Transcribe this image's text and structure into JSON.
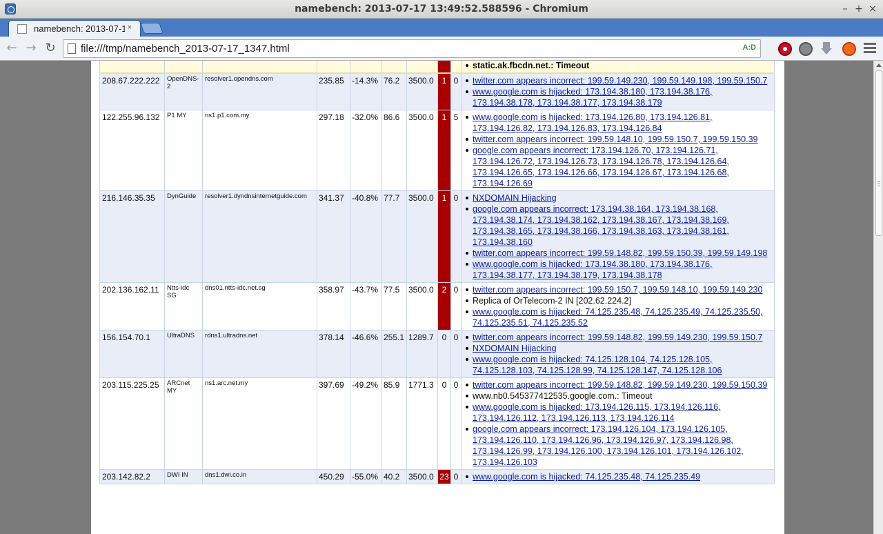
{
  "window": {
    "title": "namebench: 2013-07-17 13:49:52.588596 - Chromium",
    "min": "–",
    "max": "+",
    "close": "×"
  },
  "tab": {
    "label": "namebench: 2013-07-17 1",
    "close": "×"
  },
  "toolbar": {
    "back": "←",
    "forward": "→",
    "reload": "↻",
    "url": "file:///tmp/namebench_2013-07-17_1347.html",
    "aid": "A:D"
  },
  "results": {
    "top_row": {
      "notes": [
        "static.ak.fbcdn.net.: Timeout"
      ]
    },
    "rows": [
      {
        "ip": "208.67.222.222",
        "name": "OpenDNS-2",
        "host": "resolver1.opendns.com",
        "avg": "235.85",
        "diff": "-14.3%",
        "min": "76.2",
        "max": "3500.0",
        "errors": "1",
        "nx": "0",
        "notes": [
          {
            "text": "twitter.com appears incorrect: 199.59.149.230, 199.59.149.198, 199.59.150.7",
            "link": true
          },
          {
            "text": "www.google.com is hijacked: 173.194.38.180, 173.194.38.176, 173.194.38.178, 173.194.38.177, 173.194.38.179",
            "link": true
          }
        ]
      },
      {
        "ip": "122.255.96.132",
        "name": "P1 MY",
        "host": "ns1.p1.com.my",
        "avg": "297.18",
        "diff": "-32.0%",
        "min": "86.6",
        "max": "3500.0",
        "errors": "1",
        "nx": "5",
        "notes": [
          {
            "text": "www.google.com is hijacked: 173.194.126.80, 173.194.126.81, 173.194.126.82, 173.194.126.83, 173.194.126.84",
            "link": true
          },
          {
            "text": "twitter.com appears incorrect: 199.59.148.10, 199.59.150.7, 199.59.150.39",
            "link": true
          },
          {
            "text": "google.com appears incorrect: 173.194.126.70, 173.194.126.71, 173.194.126.72, 173.194.126.73, 173.194.126.78, 173.194.126.64, 173.194.126.65, 173.194.126.66, 173.194.126.67, 173.194.126.68, 173.194.126.69",
            "link": true
          }
        ]
      },
      {
        "ip": "216.146.35.35",
        "name": "DynGuide",
        "host": "resolver1.dyndnsinternetguide.com",
        "avg": "341.37",
        "diff": "-40.8%",
        "min": "77.7",
        "max": "3500.0",
        "errors": "1",
        "nx": "0",
        "notes": [
          {
            "text": "NXDOMAIN Hijacking",
            "link": true
          },
          {
            "text": "google.com appears incorrect: 173.194.38.164, 173.194.38.168, 173.194.38.174, 173.194.38.162, 173.194.38.167, 173.194.38.169, 173.194.38.165, 173.194.38.166, 173.194.38.163, 173.194.38.161, 173.194.38.160",
            "link": true
          },
          {
            "text": "twitter.com appears incorrect: 199.59.148.82, 199.59.150.39, 199.59.149.198",
            "link": true
          },
          {
            "text": "www.google.com is hijacked: 173.194.38.180, 173.194.38.176, 173.194.38.177, 173.194.38.179, 173.194.38.178",
            "link": true
          }
        ]
      },
      {
        "ip": "202.136.162.11",
        "name": "Ntts-idc SG",
        "host": "dns01.ntts-idc.net.sg",
        "avg": "358.97",
        "diff": "-43.7%",
        "min": "77.5",
        "max": "3500.0",
        "errors": "2",
        "nx": "0",
        "notes": [
          {
            "text": "twitter.com appears incorrect: 199.59.150.7, 199.59.148.10, 199.59.149.230",
            "link": true
          },
          {
            "text": "Replica of OrTelecom-2 IN [202.62.224.2]",
            "link": false
          },
          {
            "text": "www.google.com is hijacked: 74.125.235.48, 74.125.235.49, 74.125.235.50, 74.125.235.51, 74.125.235.52",
            "link": true
          }
        ]
      },
      {
        "ip": "156.154.70.1",
        "name": "UltraDNS",
        "host": "rdns1.ultradns.net",
        "avg": "378.14",
        "diff": "-46.6%",
        "min": "255.1",
        "max": "1289.7",
        "errors": "0",
        "nx": "0",
        "notes": [
          {
            "text": "twitter.com appears incorrect: 199.59.148.82, 199.59.149.230, 199.59.150.7",
            "link": true
          },
          {
            "text": "NXDOMAIN Hijacking",
            "link": true
          },
          {
            "text": "www.google.com is hijacked: 74.125.128.104, 74.125.128.105, 74.125.128.103, 74.125.128.99, 74.125.128.147, 74.125.128.106",
            "link": true
          }
        ]
      },
      {
        "ip": "203.115.225.25",
        "name": "ARCnet MY",
        "host": "ns1.arc.net.my",
        "avg": "397.69",
        "diff": "-49.2%",
        "min": "85.9",
        "max": "1771.3",
        "errors": "0",
        "nx": "0",
        "notes": [
          {
            "text": "twitter.com appears incorrect: 199.59.148.82, 199.59.149.230, 199.59.150.39",
            "link": true
          },
          {
            "text": "www.nb0.545377412535.google.com.: Timeout",
            "link": false
          },
          {
            "text": "www.google.com is hijacked: 173.194.126.115, 173.194.126.116, 173.194.126.112, 173.194.126.113, 173.194.126.114",
            "link": true
          },
          {
            "text": "google.com appears incorrect: 173.194.126.104, 173.194.126.105, 173.194.126.110, 173.194.126.96, 173.194.126.97, 173.194.126.98, 173.194.126.99, 173.194.126.100, 173.194.126.101, 173.194.126.102, 173.194.126.103",
            "link": true
          }
        ]
      },
      {
        "ip": "203.142.82.2",
        "name": "DWI IN",
        "host": "dns1.dwi.co.in",
        "avg": "450.29",
        "diff": "-55.0%",
        "min": "40.2",
        "max": "3500.0",
        "errors": "23",
        "nx": "0",
        "notes": [
          {
            "text": "www.google.com is hijacked: 74.125.235.48, 74.125.235.49",
            "link": true
          }
        ]
      }
    ]
  },
  "colors": {
    "error_cell": "#a80000",
    "link": "#0a1ea6",
    "alt_row": "#e8edf8",
    "highlight_row": "#fffbdc",
    "tabstrip": "#4a7bc4"
  }
}
